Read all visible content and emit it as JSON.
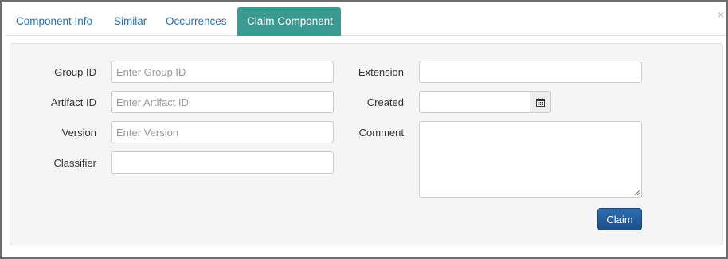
{
  "tabs": [
    {
      "label": "Component Info",
      "active": false
    },
    {
      "label": "Similar",
      "active": false
    },
    {
      "label": "Occurrences",
      "active": false
    },
    {
      "label": "Claim Component",
      "active": true
    }
  ],
  "close_label": "×",
  "form": {
    "group_id": {
      "label": "Group ID",
      "placeholder": "Enter Group ID",
      "value": ""
    },
    "artifact_id": {
      "label": "Artifact ID",
      "placeholder": "Enter Artifact ID",
      "value": ""
    },
    "version": {
      "label": "Version",
      "placeholder": "Enter Version",
      "value": ""
    },
    "classifier": {
      "label": "Classifier",
      "placeholder": "",
      "value": ""
    },
    "extension": {
      "label": "Extension",
      "placeholder": "",
      "value": ""
    },
    "created": {
      "label": "Created",
      "placeholder": "",
      "value": ""
    },
    "comment": {
      "label": "Comment",
      "placeholder": "",
      "value": ""
    }
  },
  "claim_button": "Claim",
  "colors": {
    "accent": "#3a9990",
    "link": "#2a73b5",
    "primary_button": "#1b4f8a"
  },
  "icons": {
    "calendar": "calendar-icon",
    "close": "close-icon",
    "resize": "resize-grip-icon"
  }
}
